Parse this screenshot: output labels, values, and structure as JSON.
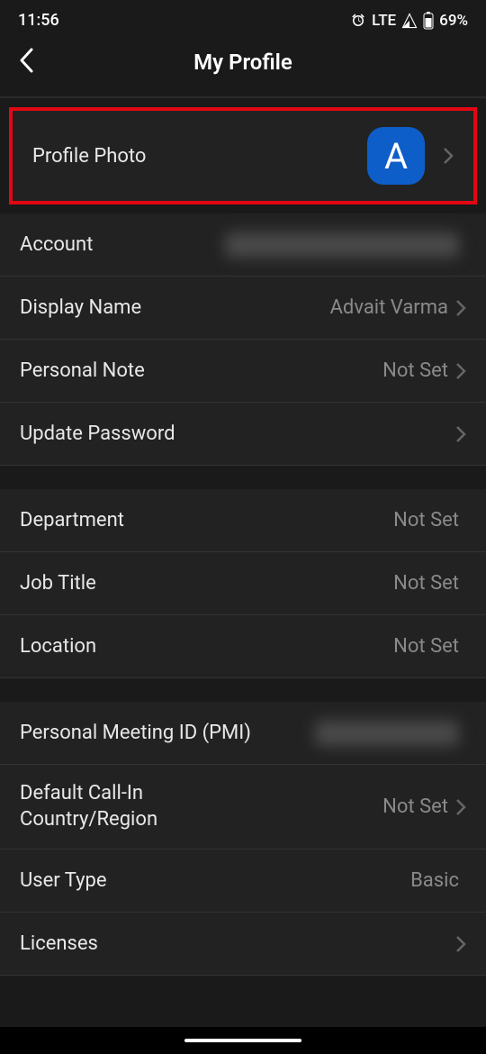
{
  "statusBar": {
    "time": "11:56",
    "network": "LTE",
    "battery": "69%"
  },
  "header": {
    "title": "My Profile"
  },
  "avatar": {
    "initial": "A"
  },
  "rows": {
    "profilePhoto": {
      "label": "Profile Photo"
    },
    "account": {
      "label": "Account",
      "value": ""
    },
    "displayName": {
      "label": "Display Name",
      "value": "Advait Varma"
    },
    "personalNote": {
      "label": "Personal Note",
      "value": "Not Set"
    },
    "updatePassword": {
      "label": "Update Password"
    },
    "department": {
      "label": "Department",
      "value": "Not Set"
    },
    "jobTitle": {
      "label": "Job Title",
      "value": "Not Set"
    },
    "location": {
      "label": "Location",
      "value": "Not Set"
    },
    "pmi": {
      "label": "Personal Meeting ID (PMI)",
      "value": ""
    },
    "callInCountry": {
      "label": "Default Call-In Country/Region",
      "value": "Not Set"
    },
    "userType": {
      "label": "User Type",
      "value": "Basic"
    },
    "licenses": {
      "label": "Licenses"
    }
  }
}
